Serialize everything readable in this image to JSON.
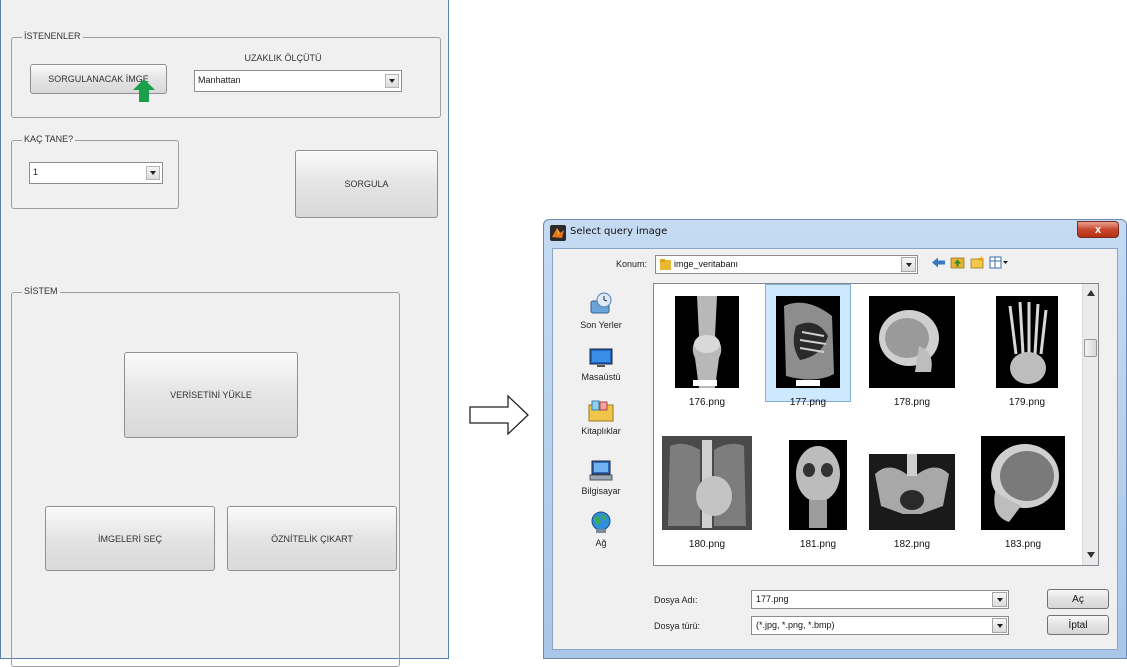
{
  "gui": {
    "istenenler_title": "İSTENENLER",
    "query_image_button": "SORGULANACAK İMGE",
    "distance_label": "UZAKLIK ÖLÇÜTÜ",
    "distance_select_value": "Manhattan",
    "kac_tane_title": "KAÇ TANE?",
    "count_select_value": "1",
    "query_button": "SORGULA",
    "sistem_title": "SİSTEM",
    "load_dataset_button": "VERİSETİNİ YÜKLE",
    "select_images_button": "İMGELERİ SEÇ",
    "extract_features_button": "ÖZNİTELİK ÇIKART",
    "cursor_color": "#1aa04a"
  },
  "dialog": {
    "title": "Select query image",
    "close_label": "x",
    "location_label": "Konum:",
    "location_value": "imge_veritabanı",
    "places": [
      {
        "label": "Son Yerler",
        "icon": "recent-places-icon"
      },
      {
        "label": "Masaüstü",
        "icon": "desktop-icon"
      },
      {
        "label": "Kitaplıklar",
        "icon": "libraries-icon"
      },
      {
        "label": "Bilgisayar",
        "icon": "computer-icon"
      },
      {
        "label": "Ağ",
        "icon": "network-icon"
      }
    ],
    "files": [
      {
        "name": "176.png",
        "selected": false
      },
      {
        "name": "177.png",
        "selected": true
      },
      {
        "name": "178.png",
        "selected": false
      },
      {
        "name": "179.png",
        "selected": false
      },
      {
        "name": "180.png",
        "selected": false
      },
      {
        "name": "181.png",
        "selected": false
      },
      {
        "name": "182.png",
        "selected": false
      },
      {
        "name": "183.png",
        "selected": false
      }
    ],
    "filename_label": "Dosya Adı:",
    "filename_value": "177.png",
    "filetype_label": "Dosya türü:",
    "filetype_value": "(*.jpg, *.png, *.bmp)",
    "open_button": "Aç",
    "cancel_button": "İptal"
  }
}
